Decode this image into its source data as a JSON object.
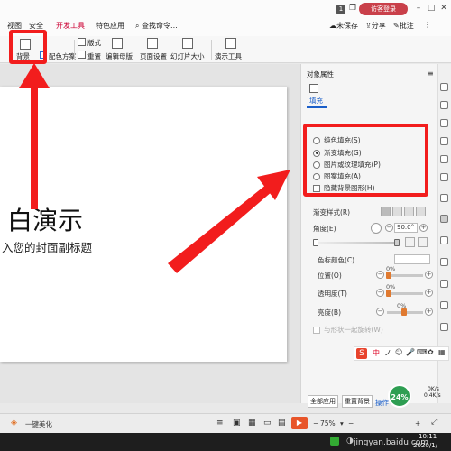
{
  "tabs": {
    "view": "视图",
    "security": "安全",
    "devtools": "开发工具",
    "features": "特色应用",
    "search": "查找命令..."
  },
  "topbar": {
    "page_no": "1",
    "guest_login": "访客登录",
    "unsaved": "未保存",
    "share": "分享",
    "comment": "批注"
  },
  "toolbar": {
    "background": "背景",
    "color_scheme": "配色方案",
    "layout": "版式",
    "reset": "重置",
    "edit_master": "编辑母版",
    "page_setup": "页面设置",
    "slide_size": "幻灯片大小",
    "presentation_tools": "演示工具"
  },
  "slide": {
    "title": "白演示",
    "subtitle": "入您的封面副标题"
  },
  "pane": {
    "title": "对象属性",
    "tab_fill": "填充",
    "options": [
      {
        "label": "纯色填充(S)",
        "selected": false
      },
      {
        "label": "渐变填充(G)",
        "selected": true
      },
      {
        "label": "图片或纹理填充(P)",
        "selected": false
      },
      {
        "label": "图案填充(A)",
        "selected": false
      }
    ],
    "hide_bg": "隐藏背景图形(H)",
    "gradient_style": "渐变样式(R)",
    "angle_label": "角度(E)",
    "angle_value": "90.0°",
    "stop_color_label": "色标颜色(C)",
    "position_label": "位置(O)",
    "position_value": "0%",
    "transparency_label": "透明度(T)",
    "transparency_value": "0%",
    "brightness_label": "亮度(B)",
    "brightness_value": "0%",
    "rotate_with_shape": "与形状一起旋转(W)",
    "apply_all": "全部应用",
    "reset_bg": "重置背景",
    "ops": "操作"
  },
  "status": {
    "beautify": "一键美化",
    "zoom": "75%"
  },
  "ime": {
    "lang": "中"
  },
  "netball": {
    "percent": "24%",
    "up": "0K/s",
    "down": "0.4K/s"
  },
  "taskbar": {
    "time": "10:11",
    "date": "2020/1/",
    "watermark": "jingyan.baidu.com"
  },
  "colors": {
    "accent_red": "#f21d1d",
    "guest_btn": "#c9404a",
    "link_blue": "#1a5ec9"
  }
}
